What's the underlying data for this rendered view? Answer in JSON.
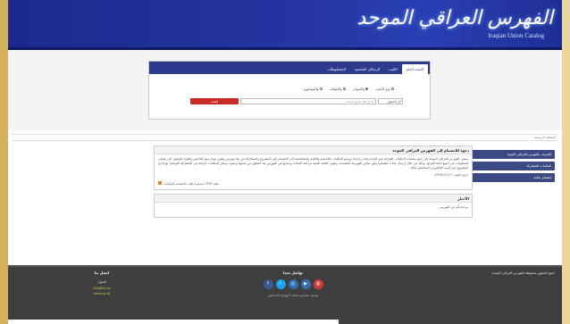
{
  "header": {
    "logo_arabic": "الفهرس العراقي الموحد",
    "logo_english": "Iraqian Union Catalog"
  },
  "search": {
    "tabs": [
      {
        "label": "البحث العام",
        "active": true
      },
      {
        "label": "الكتب",
        "active": false
      },
      {
        "label": "الرسائل الجامعية",
        "active": false
      },
      {
        "label": "المخطوطات",
        "active": false
      }
    ],
    "radios": [
      {
        "label": "نوع البحث",
        "checked": false
      },
      {
        "label": "والعنوان",
        "checked": true
      },
      {
        "label": "والمؤلف",
        "checked": false
      },
      {
        "label": "والموضوع",
        "checked": false
      }
    ],
    "scope_value": "كل الحقول",
    "input_placeholder": "أدخل هنا عبارة البحث",
    "button_label": "ابحث"
  },
  "breadcrumb": "الصفحة الرئيسية",
  "sidebar": {
    "items": [
      "التعريف بالفهرس العراقي الموحد",
      "المكتبات المشاركة",
      "انضمام مكتبة"
    ]
  },
  "news": {
    "title": "دعوة للانضمام إلى الفهرس العراقي الموحد",
    "body": "يسعى الفهرس العراقي الموحد إلى جمع مقتنيات المكتبات العراقية في قاعدة بيانات واحدة، ويدعو المكتبات الجامعية والعامة والمتخصصة إلى الانضمام إلى المشروع والمشاركة في بناء فهرس وطني موحد يتيح للباحثين والقراء الوصول إلى مصادر المعلومات في جميع أنحاء العراق، وذلك من خلال إرسال بيانات مقتنياتها وفق معايير الفهرسة المعتمدة، وتتولى اللجنة الفنية مراجعة البيانات ودمجها في الفهرس بعد التحقق من صحتها ودقتها، ويمكن للمكتبات الراغبة في المشاركة التواصل مع إدارة المشروع عبر البريد الإلكتروني المخصص لذلك.",
    "date_label": "تاريخ النشر: 2019/12/17",
    "attachment_label": "ملف PDF: استمارة طلب الانضمام للمكتبات"
  },
  "second_card": {
    "title": "الأخبار",
    "body": "مرحبا بكم في الفهرس"
  },
  "footer": {
    "copyright": "جميع الحقوق محفوظة للفهرس العراقي الموحد",
    "contact_title": "تواصل معنا",
    "social": [
      {
        "name": "facebook-icon",
        "glyph": "f",
        "color": "#3b5998"
      },
      {
        "name": "twitter-icon",
        "glyph": "t",
        "color": "#1da1f2"
      },
      {
        "name": "instagram-icon",
        "glyph": "◎",
        "color": "#2f6fb8"
      },
      {
        "name": "youtube-icon",
        "glyph": "▶",
        "color": "#3b6fb0"
      },
      {
        "name": "email-icon",
        "glyph": "@",
        "color": "#d23b35"
      }
    ],
    "contact_note": "تواصل معنا عبر شبكات التواصل الاجتماعي",
    "links_title": "اتصل بنا",
    "links_label": "العنوان",
    "links_link1": "info@iuc.iq",
    "links_link2": "www.iuc.iq"
  }
}
